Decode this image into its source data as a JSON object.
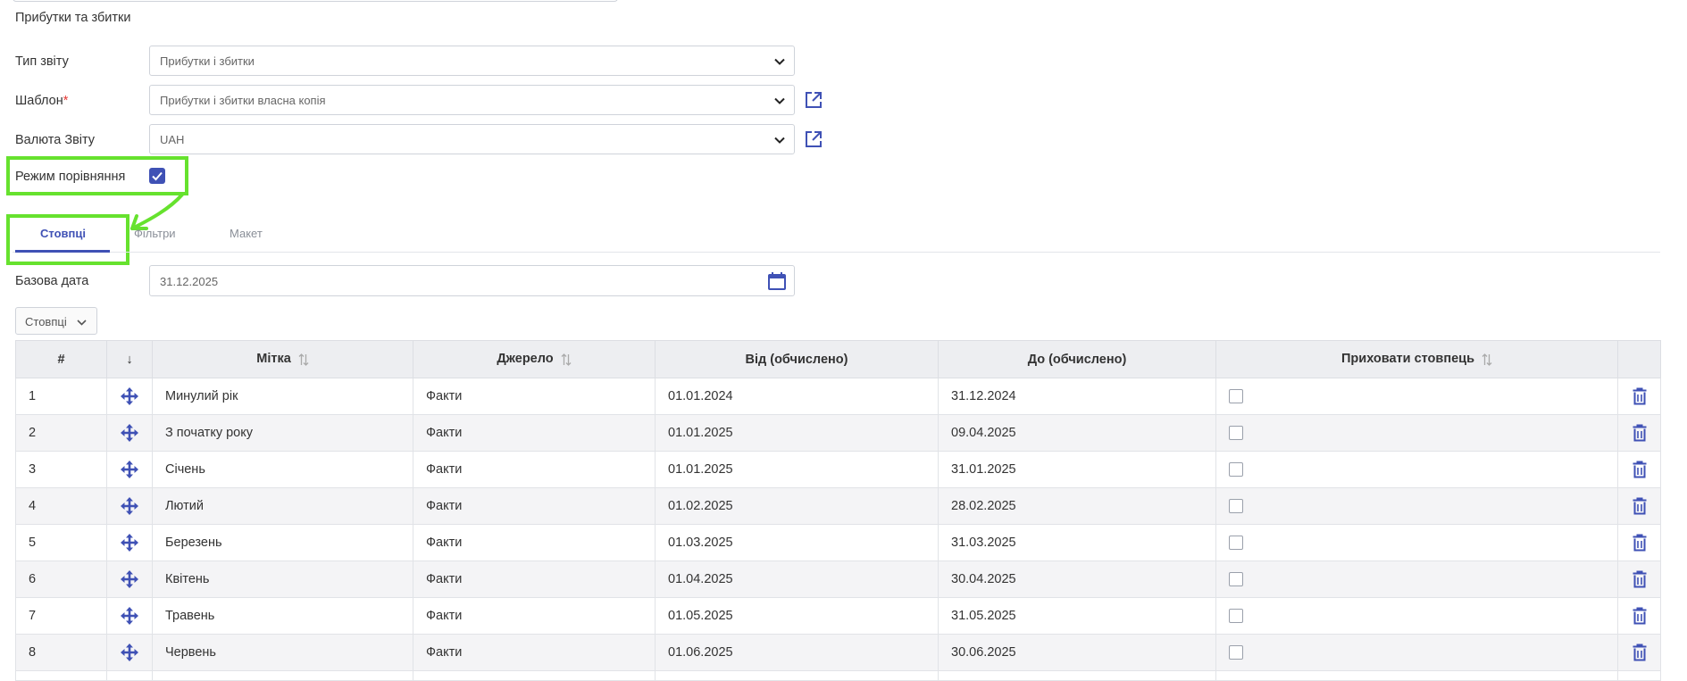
{
  "report_name": "Прибутки та збитки",
  "form": {
    "report_type_label": "Тип звіту",
    "report_type_value": "Прибутки і збитки",
    "template_label": "Шаблон",
    "template_required_mark": "*",
    "template_value": "Прибутки і збитки власна копія",
    "currency_label": "Валюта Звіту",
    "currency_value": "UAH",
    "comparison_label": "Режим порівняння",
    "comparison_checked": true
  },
  "tabs": [
    {
      "label": "Стовпці",
      "active": true
    },
    {
      "label": "Фільтри",
      "active": false
    },
    {
      "label": "Макет",
      "active": false
    }
  ],
  "base_date": {
    "label": "Базова дата",
    "value": "31.12.2025"
  },
  "columns_dropdown_label": "Стовпці",
  "table": {
    "headers": {
      "index": "#",
      "move": "↓",
      "label": "Мітка",
      "source": "Джерело",
      "from": "Від (обчислено)",
      "to": "До (обчислено)",
      "hide": "Приховати стовпець"
    },
    "rows": [
      {
        "index": "1",
        "label": "Минулий рік",
        "source": "Факти",
        "from": "01.01.2024",
        "to": "31.12.2024",
        "hidden": false
      },
      {
        "index": "2",
        "label": "З початку року",
        "source": "Факти",
        "from": "01.01.2025",
        "to": "09.04.2025",
        "hidden": false
      },
      {
        "index": "3",
        "label": "Січень",
        "source": "Факти",
        "from": "01.01.2025",
        "to": "31.01.2025",
        "hidden": false
      },
      {
        "index": "4",
        "label": "Лютий",
        "source": "Факти",
        "from": "01.02.2025",
        "to": "28.02.2025",
        "hidden": false
      },
      {
        "index": "5",
        "label": "Березень",
        "source": "Факти",
        "from": "01.03.2025",
        "to": "31.03.2025",
        "hidden": false
      },
      {
        "index": "6",
        "label": "Квітень",
        "source": "Факти",
        "from": "01.04.2025",
        "to": "30.04.2025",
        "hidden": false
      },
      {
        "index": "7",
        "label": "Травень",
        "source": "Факти",
        "from": "01.05.2025",
        "to": "31.05.2025",
        "hidden": false
      },
      {
        "index": "8",
        "label": "Червень",
        "source": "Факти",
        "from": "01.06.2025",
        "to": "30.06.2025",
        "hidden": false
      },
      {
        "index": "",
        "label": "",
        "source": "",
        "from": "",
        "to": "",
        "hidden": false
      }
    ]
  },
  "icons": {
    "move": "move-arrows-icon",
    "delete": "trash-icon",
    "sort": "sort-arrows-icon",
    "external": "external-link-icon",
    "calendar": "calendar-icon",
    "chevron": "chevron-down-icon",
    "check": "checkmark-icon"
  },
  "colors": {
    "accent": "#3f51b5",
    "highlight": "#66e22e",
    "required": "#e53935"
  }
}
